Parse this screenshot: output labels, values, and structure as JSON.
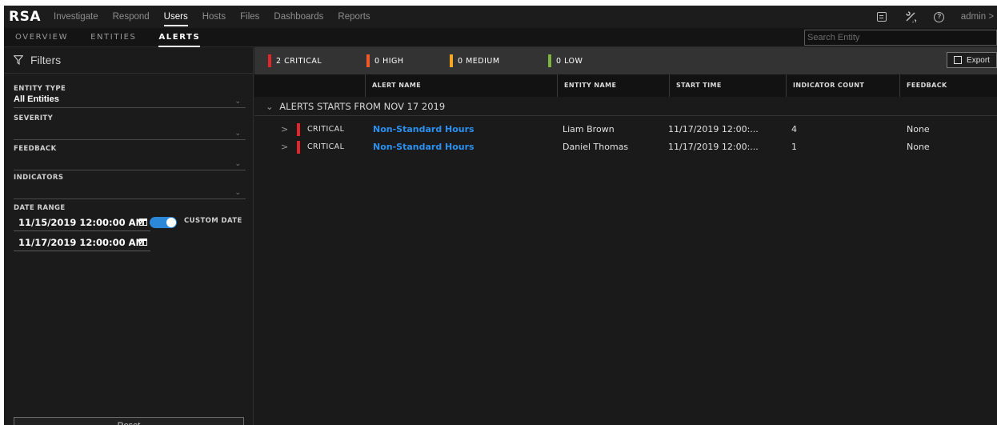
{
  "topnav": {
    "logo": "RSA",
    "items": [
      "Investigate",
      "Respond",
      "Users",
      "Hosts",
      "Files",
      "Dashboards",
      "Reports"
    ],
    "active": "Users",
    "user": "admin >"
  },
  "subnav": {
    "tabs": [
      "OVERVIEW",
      "ENTITIES",
      "ALERTS"
    ],
    "active": "ALERTS",
    "search_placeholder": "Search Entity"
  },
  "filters": {
    "title": "Filters",
    "entity_type_label": "ENTITY TYPE",
    "entity_type_value": "All Entities",
    "severity_label": "SEVERITY",
    "feedback_label": "FEEDBACK",
    "indicators_label": "INDICATORS",
    "date_range_label": "DATE RANGE",
    "date_from": "11/15/2019 12:00:00 AM",
    "date_to": "11/17/2019 12:00:00 AM",
    "custom_date_label": "CUSTOM DATE",
    "custom_date_on": true,
    "reset_label": "Reset"
  },
  "severity_summary": {
    "critical": "2 CRITICAL",
    "high": "0 HIGH",
    "medium": "0 MEDIUM",
    "low": "0 LOW",
    "colors": {
      "critical": "#e4252b",
      "high": "#f0582a",
      "medium": "#f5a623",
      "low": "#7db33f"
    },
    "export_label": "Export"
  },
  "table": {
    "columns": [
      "ALERT NAME",
      "ENTITY NAME",
      "START TIME",
      "INDICATOR COUNT",
      "FEEDBACK"
    ],
    "group_label": "ALERTS STARTS FROM  NOV 17 2019",
    "rows": [
      {
        "severity": "CRITICAL",
        "alert_name": "Non-Standard Hours",
        "entity_name": "Liam Brown",
        "start_time": "11/17/2019 12:00:...",
        "indicator_count": "4",
        "feedback": "None"
      },
      {
        "severity": "CRITICAL",
        "alert_name": "Non-Standard Hours",
        "entity_name": "Daniel Thomas",
        "start_time": "11/17/2019 12:00:...",
        "indicator_count": "1",
        "feedback": "None"
      }
    ]
  }
}
